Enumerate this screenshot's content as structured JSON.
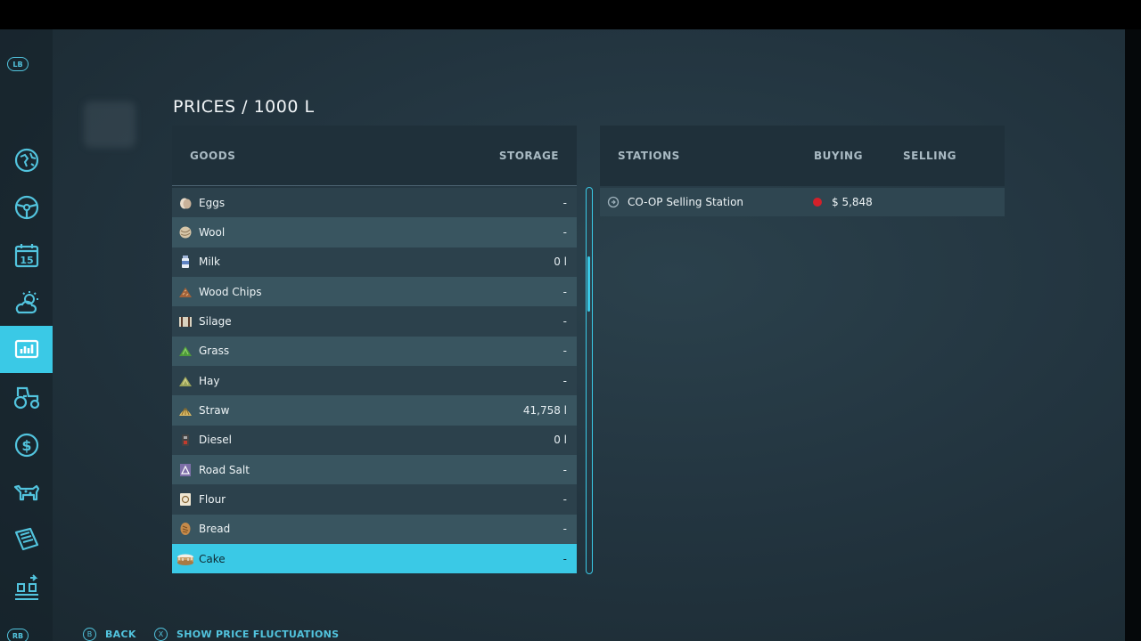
{
  "title": "PRICES / 1000 L",
  "goods_table": {
    "col_goods": "GOODS",
    "col_storage": "STORAGE",
    "rows": [
      {
        "name": "Eggs",
        "storage": "-",
        "icon": "eggs-icon"
      },
      {
        "name": "Wool",
        "storage": "-",
        "icon": "wool-icon"
      },
      {
        "name": "Milk",
        "storage": "0 l",
        "icon": "milk-icon"
      },
      {
        "name": "Wood Chips",
        "storage": "-",
        "icon": "wood-chips-icon"
      },
      {
        "name": "Silage",
        "storage": "-",
        "icon": "silage-icon"
      },
      {
        "name": "Grass",
        "storage": "-",
        "icon": "grass-icon"
      },
      {
        "name": "Hay",
        "storage": "-",
        "icon": "hay-icon"
      },
      {
        "name": "Straw",
        "storage": "41,758 l",
        "icon": "straw-icon"
      },
      {
        "name": "Diesel",
        "storage": "0 l",
        "icon": "diesel-icon"
      },
      {
        "name": "Road Salt",
        "storage": "-",
        "icon": "road-salt-icon"
      },
      {
        "name": "Flour",
        "storage": "-",
        "icon": "flour-icon"
      },
      {
        "name": "Bread",
        "storage": "-",
        "icon": "bread-icon"
      },
      {
        "name": "Cake",
        "storage": "-",
        "icon": "cake-icon",
        "selected": true
      }
    ]
  },
  "stations_table": {
    "col_stations": "STATIONS",
    "col_buying": "BUYING",
    "col_selling": "SELLING",
    "rows": [
      {
        "name": "CO-OP Selling Station",
        "buying": "$ 5,848",
        "trend": "down"
      }
    ]
  },
  "sidebar": {
    "top_hint": "LB",
    "bottom_hint": "RB",
    "items": [
      {
        "icon": "map-icon"
      },
      {
        "icon": "steering-wheel-icon"
      },
      {
        "icon": "calendar-icon",
        "label": "15"
      },
      {
        "icon": "weather-icon"
      },
      {
        "icon": "prices-chart-icon",
        "active": true
      },
      {
        "icon": "tractor-icon"
      },
      {
        "icon": "finances-icon"
      },
      {
        "icon": "animals-icon"
      },
      {
        "icon": "contracts-icon"
      },
      {
        "icon": "production-icon"
      }
    ]
  },
  "hints": {
    "back_key": "B",
    "back_label": "BACK",
    "fluct_key": "X",
    "fluct_label": "SHOW PRICE FLUCTUATIONS"
  },
  "colors": {
    "accent": "#3ac9e6",
    "alert": "#d4202a"
  }
}
